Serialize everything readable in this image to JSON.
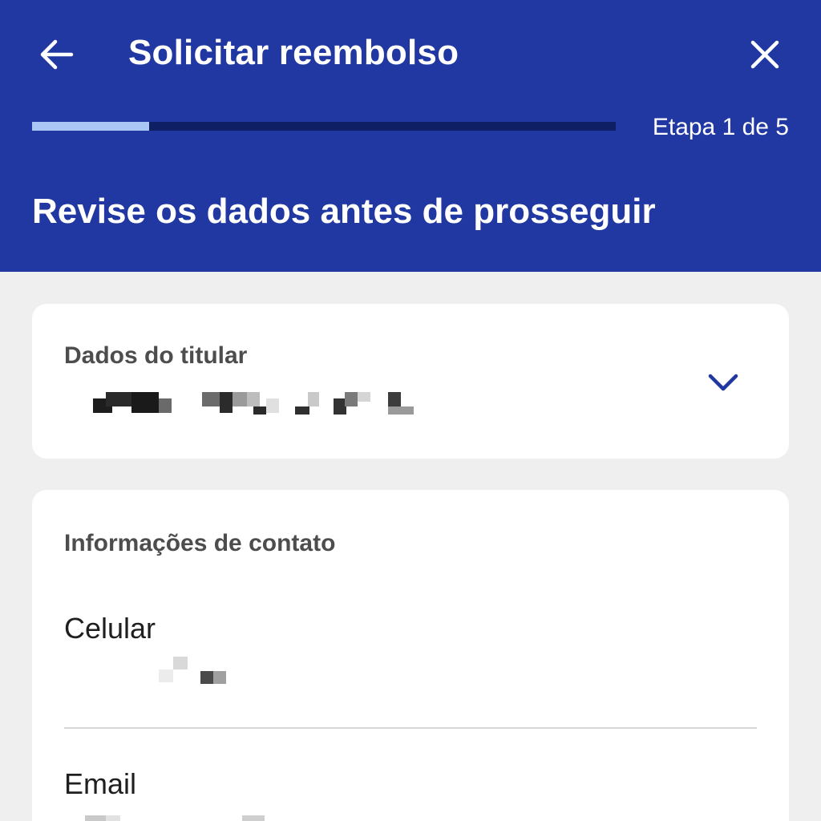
{
  "header": {
    "title": "Solicitar reembolso",
    "step_text": "Etapa 1 de 5",
    "step_progress_fraction": 0.2,
    "subtitle": "Revise os dados antes de prosseguir",
    "back_icon": "arrow-left-icon",
    "close_icon": "close-icon"
  },
  "holder_card": {
    "label": "Dados do titular",
    "value": "",
    "expand_icon": "chevron-down-icon"
  },
  "contact_card": {
    "label": "Informações de contato",
    "phone_label": "Celular",
    "phone_value": "",
    "email_label": "Email",
    "email_value": ""
  },
  "colors": {
    "header_bg": "#2137a1",
    "progress_track": "#0f1f63",
    "progress_fill": "#a9c6f5",
    "page_bg": "#efefef",
    "card_bg": "#ffffff",
    "accent": "#2137a1"
  }
}
